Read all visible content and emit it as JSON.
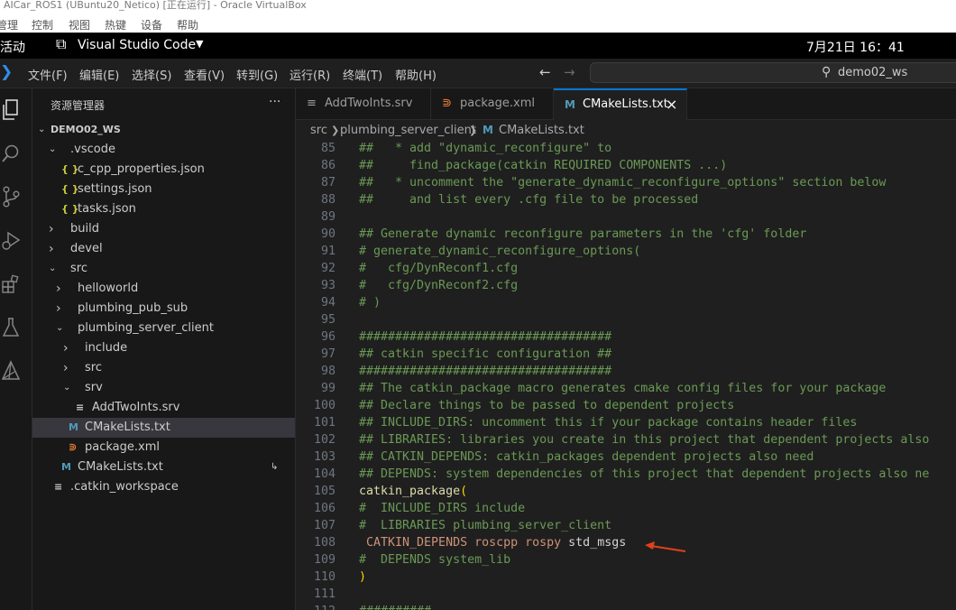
{
  "vbox": {
    "title": "AICar_ROS1 (UBuntu20_Netico) [正在运行] - Oracle VirtualBox",
    "menu": [
      "管理",
      "控制",
      "视图",
      "热键",
      "设备",
      "帮助"
    ]
  },
  "gnome": {
    "activities": "活动",
    "app_name": "Visual Studio Code",
    "clock": "7月21日  16：41"
  },
  "menubar": {
    "items": [
      "文件(F)",
      "编辑(E)",
      "选择(S)",
      "查看(V)",
      "转到(G)",
      "运行(R)",
      "终端(T)",
      "帮助(H)"
    ],
    "search_text": "demo02_ws"
  },
  "sidebar": {
    "title": "资源管理器",
    "more": "···",
    "root": "DEMO02_WS",
    "tree": [
      {
        "label": ".vscode",
        "depth": 1,
        "kind": "folder",
        "open": true
      },
      {
        "label": "c_cpp_properties.json",
        "depth": 2,
        "kind": "json"
      },
      {
        "label": "settings.json",
        "depth": 2,
        "kind": "json"
      },
      {
        "label": "tasks.json",
        "depth": 2,
        "kind": "json"
      },
      {
        "label": "build",
        "depth": 1,
        "kind": "folder",
        "open": false
      },
      {
        "label": "devel",
        "depth": 1,
        "kind": "folder",
        "open": false
      },
      {
        "label": "src",
        "depth": 1,
        "kind": "folder",
        "open": true
      },
      {
        "label": "helloworld",
        "depth": 2,
        "kind": "folder",
        "open": false
      },
      {
        "label": "plumbing_pub_sub",
        "depth": 2,
        "kind": "folder",
        "open": false
      },
      {
        "label": "plumbing_server_client",
        "depth": 2,
        "kind": "folder",
        "open": true
      },
      {
        "label": "include",
        "depth": 3,
        "kind": "folder",
        "open": false
      },
      {
        "label": "src",
        "depth": 3,
        "kind": "folder",
        "open": false
      },
      {
        "label": "srv",
        "depth": 3,
        "kind": "folder",
        "open": true
      },
      {
        "label": "AddTwoInts.srv",
        "depth": 4,
        "kind": "lines"
      },
      {
        "label": "CMakeLists.txt",
        "depth": 3,
        "kind": "cmake",
        "selected": true
      },
      {
        "label": "package.xml",
        "depth": 3,
        "kind": "rss"
      },
      {
        "label": "CMakeLists.txt",
        "depth": 2,
        "kind": "cmake",
        "extra": "↳"
      },
      {
        "label": ".catkin_workspace",
        "depth": 1,
        "kind": "lines"
      }
    ]
  },
  "tabs": [
    {
      "label": "AddTwoInts.srv",
      "icon": "≡",
      "icon_color": "#cccccc"
    },
    {
      "label": "package.xml",
      "icon": "⋑",
      "icon_color": "#e37933"
    },
    {
      "label": "CMakeLists.txt",
      "icon": "M",
      "icon_color": "#519aba",
      "active": true,
      "close": "×"
    }
  ],
  "breadcrumb": [
    "src",
    "plumbing_server_client",
    "CMakeLists.txt"
  ],
  "code": [
    {
      "n": "85",
      "parts": [
        [
          "c",
          "##   * add \"dynamic_reconfigure\" to"
        ]
      ]
    },
    {
      "n": "86",
      "parts": [
        [
          "c",
          "##     find_package(catkin REQUIRED COMPONENTS ...)"
        ]
      ]
    },
    {
      "n": "87",
      "parts": [
        [
          "c",
          "##   * uncomment the \"generate_dynamic_reconfigure_options\" section below"
        ]
      ]
    },
    {
      "n": "88",
      "parts": [
        [
          "c",
          "##     and list every .cfg file to be processed"
        ]
      ]
    },
    {
      "n": "89",
      "parts": []
    },
    {
      "n": "90",
      "parts": [
        [
          "c",
          "## Generate dynamic reconfigure parameters in the 'cfg' folder"
        ]
      ]
    },
    {
      "n": "91",
      "parts": [
        [
          "c",
          "# generate_dynamic_reconfigure_options("
        ]
      ]
    },
    {
      "n": "92",
      "parts": [
        [
          "c",
          "#   cfg/DynReconf1.cfg"
        ]
      ]
    },
    {
      "n": "93",
      "parts": [
        [
          "c",
          "#   cfg/DynReconf2.cfg"
        ]
      ]
    },
    {
      "n": "94",
      "parts": [
        [
          "c",
          "# )"
        ]
      ]
    },
    {
      "n": "95",
      "parts": []
    },
    {
      "n": "96",
      "parts": [
        [
          "c",
          "###################################"
        ]
      ]
    },
    {
      "n": "97",
      "parts": [
        [
          "c",
          "## catkin specific configuration ##"
        ]
      ]
    },
    {
      "n": "98",
      "parts": [
        [
          "c",
          "###################################"
        ]
      ]
    },
    {
      "n": "99",
      "parts": [
        [
          "c",
          "## The catkin_package macro generates cmake config files for your package"
        ]
      ]
    },
    {
      "n": "100",
      "parts": [
        [
          "c",
          "## Declare things to be passed to dependent projects"
        ]
      ]
    },
    {
      "n": "101",
      "parts": [
        [
          "c",
          "## INCLUDE_DIRS: uncomment this if your package contains header files"
        ]
      ]
    },
    {
      "n": "102",
      "parts": [
        [
          "c",
          "## LIBRARIES: libraries you create in this project that dependent projects also"
        ]
      ]
    },
    {
      "n": "103",
      "parts": [
        [
          "c",
          "## CATKIN_DEPENDS: catkin_packages dependent projects also need"
        ]
      ]
    },
    {
      "n": "104",
      "parts": [
        [
          "c",
          "## DEPENDS: system dependencies of this project that dependent projects also ne"
        ]
      ]
    },
    {
      "n": "105",
      "parts": [
        [
          "f",
          "catkin_package"
        ],
        [
          "p",
          "("
        ]
      ]
    },
    {
      "n": "106",
      "parts": [
        [
          "c",
          "#  INCLUDE_DIRS include"
        ]
      ]
    },
    {
      "n": "107",
      "parts": [
        [
          "c",
          "#  LIBRARIES plumbing_server_client"
        ]
      ]
    },
    {
      "n": "108",
      "parts": [
        [
          "k",
          " CATKIN_DEPENDS roscpp rospy "
        ],
        [
          "t",
          "std_msgs"
        ]
      ]
    },
    {
      "n": "109",
      "parts": [
        [
          "c",
          "#  DEPENDS system_lib"
        ]
      ]
    },
    {
      "n": "110",
      "parts": [
        [
          "p",
          ")"
        ]
      ]
    },
    {
      "n": "111",
      "parts": []
    },
    {
      "n": "112",
      "parts": [
        [
          "c",
          "##########"
        ]
      ]
    }
  ],
  "annotation_color": "#e0401e"
}
